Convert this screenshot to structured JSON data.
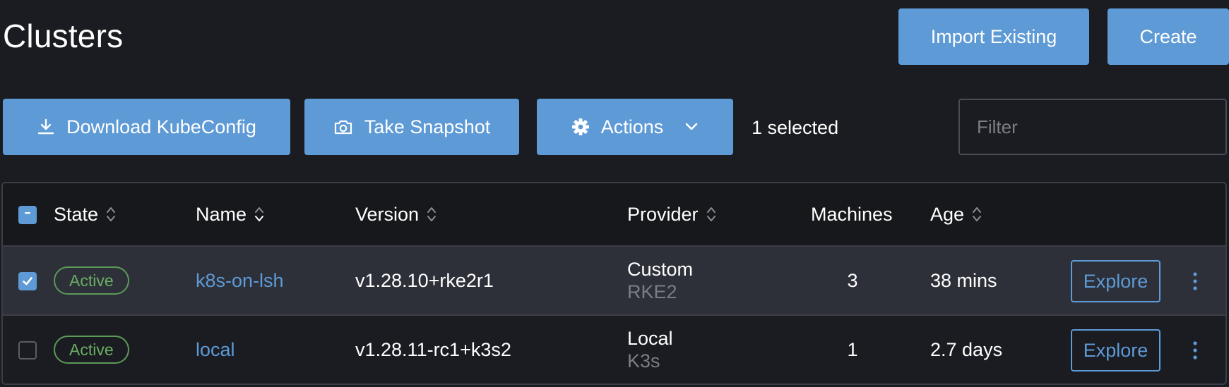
{
  "header": {
    "title": "Clusters",
    "import_label": "Import Existing",
    "create_label": "Create"
  },
  "toolbar": {
    "download_label": "Download KubeConfig",
    "snapshot_label": "Take Snapshot",
    "actions_label": "Actions",
    "selected_text": "1 selected",
    "filter_placeholder": "Filter"
  },
  "table": {
    "columns": {
      "state": "State",
      "name": "Name",
      "version": "Version",
      "provider": "Provider",
      "machines": "Machines",
      "age": "Age"
    },
    "rows": [
      {
        "selected": true,
        "state": "Active",
        "name": "k8s-on-lsh",
        "version": "v1.28.10+rke2r1",
        "provider": "Custom",
        "provider_sub": "RKE2",
        "machines": "3",
        "age": "38 mins",
        "action_label": "Explore"
      },
      {
        "selected": false,
        "state": "Active",
        "name": "local",
        "version": "v1.28.11-rc1+k3s2",
        "provider": "Local",
        "provider_sub": "K3s",
        "machines": "1",
        "age": "2.7 days",
        "action_label": "Explore"
      }
    ]
  },
  "icons": {
    "download": "download-icon",
    "snapshot": "camera-icon",
    "actions": "gear-icon",
    "actions_caret": "chevron-down-icon",
    "sort": "sort-icon",
    "kebab": "kebab-menu-icon"
  },
  "colors": {
    "background": "#1b1c21",
    "primary": "#5d9ad6",
    "active_status": "#6aae63",
    "selected_row": "#2d3039",
    "muted_text": "#7b7e86"
  }
}
